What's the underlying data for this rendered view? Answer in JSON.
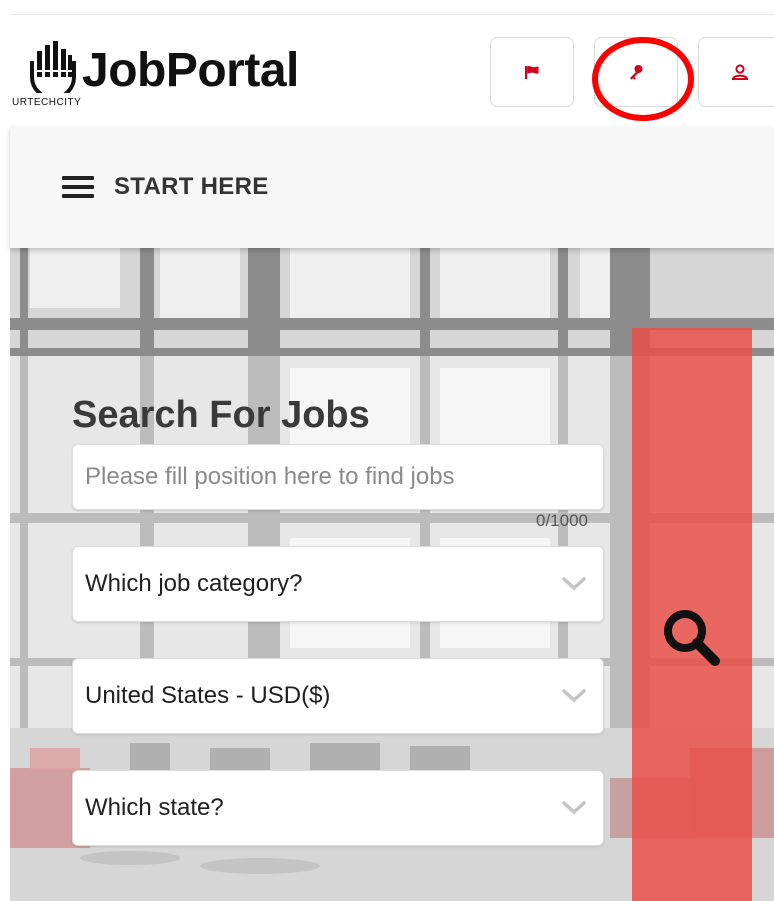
{
  "header": {
    "brand": "JobPortal",
    "brand_sub": "URTECHCITY",
    "buttons": [
      {
        "name": "flag",
        "icon": "flag-icon"
      },
      {
        "name": "login",
        "icon": "key-icon"
      },
      {
        "name": "account",
        "icon": "user-icon"
      }
    ]
  },
  "nav": {
    "label": "START HERE",
    "icon": "hamburger-icon"
  },
  "search": {
    "title": "Search For Jobs",
    "position_placeholder": "Please fill position here to find jobs",
    "position_value": "",
    "counter": "0/1000",
    "category": "Which job category?",
    "country": "United States - USD($)",
    "state": "Which state?",
    "submit_icon": "search-icon"
  },
  "colors": {
    "accent": "#d0021b",
    "search_button": "#e95048",
    "annotation": "#ff0000"
  }
}
